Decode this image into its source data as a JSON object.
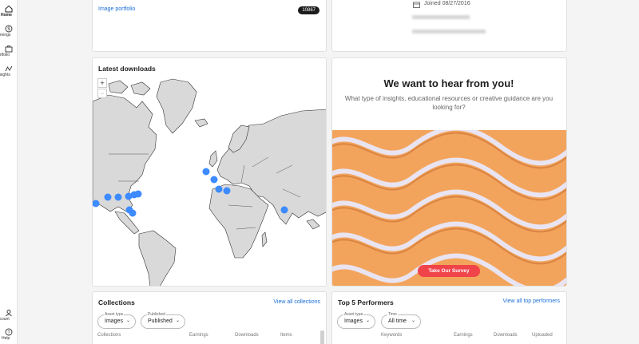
{
  "sidebar": {
    "items": [
      {
        "label": "Home",
        "icon": "home-icon"
      },
      {
        "label": "arnings",
        "icon": "dollar-icon"
      },
      {
        "label": "ortfolio",
        "icon": "portfolio-icon"
      },
      {
        "label": "nsights",
        "icon": "insights-icon"
      }
    ],
    "bottom": [
      {
        "label": "ccount",
        "icon": "account-icon"
      },
      {
        "label": "Help",
        "icon": "help-icon"
      }
    ]
  },
  "portfolio_card": {
    "link": "Image portfolio",
    "count": "10867"
  },
  "profile_card": {
    "joined": "Joined 08/27/2016"
  },
  "downloads": {
    "title": "Latest downloads",
    "zoom_in": "+",
    "zoom_out": "−"
  },
  "survey": {
    "title": "We want to hear from you!",
    "text": "What type of insights, educational resources or creative guidance are you looking for?",
    "button": "Take Our Survey"
  },
  "collections": {
    "title": "Collections",
    "link": "View all collections",
    "filter_asset": {
      "label": "Asset type",
      "value": "Images"
    },
    "filter_published": {
      "label": "Published",
      "value": "Published"
    },
    "columns": [
      "Collections",
      "Earnings",
      "Downloads",
      "Items"
    ]
  },
  "performers": {
    "title": "Top 5 Performers",
    "link": "View all top performers",
    "filter_asset": {
      "label": "Asset type",
      "value": "Images"
    },
    "filter_time": {
      "label": "Time",
      "value": "All time"
    },
    "columns": [
      "Keywords",
      "Earnings",
      "Downloads",
      "Uploaded"
    ]
  },
  "colors": {
    "accent": "#1a6ed6",
    "survey_button": "#f0434a",
    "map_dot": "#3d8bff"
  }
}
